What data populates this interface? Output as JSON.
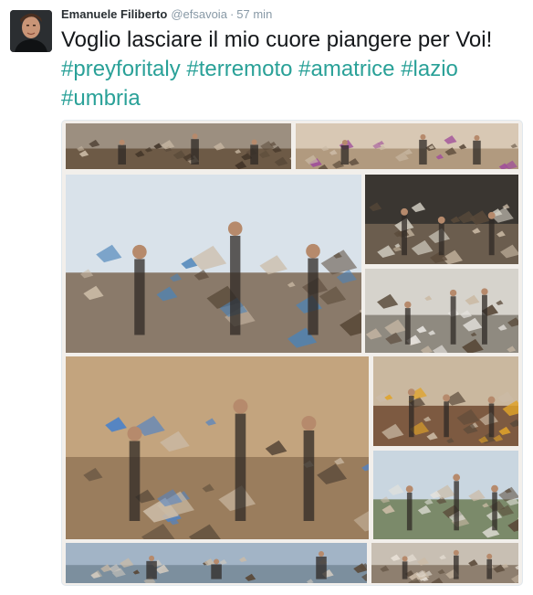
{
  "tweet": {
    "author_name": "Emanuele Filiberto",
    "handle": "@efsavoia",
    "separator": "·",
    "time": "57 min",
    "text_plain": "Voglio lasciare il mio cuore piangere per Voi! ",
    "hashtags": [
      "#preyforitaly",
      "#terremoto",
      "#amatrice",
      "#lazio",
      "#umbria"
    ]
  },
  "colors": {
    "name": "#292f33",
    "meta": "#8899a6",
    "hashtag": "#2aa198",
    "text": "#14171a"
  },
  "photos": [
    {
      "id": "rubble-top-left",
      "sky": "#9c8f80",
      "ground": "#6d5a46",
      "accent": "#3b2e22"
    },
    {
      "id": "rubble-top-right",
      "sky": "#d8c8b4",
      "ground": "#b19a7f",
      "accent": "#a04f9a"
    },
    {
      "id": "street-rescuers",
      "sky": "#d9e2ea",
      "ground": "#8a7a6a",
      "accent": "#4b83b8"
    },
    {
      "id": "night-rescue",
      "sky": "#3a3631",
      "ground": "#6b5d4e",
      "accent": "#d8d4c8"
    },
    {
      "id": "man-white-hair",
      "sky": "#d6d3cc",
      "ground": "#8f8a80",
      "accent": "#e6e3de"
    },
    {
      "id": "woman-blanket",
      "sky": "#c3a47e",
      "ground": "#9a7d5d",
      "accent": "#4f83c6"
    },
    {
      "id": "excavator",
      "sky": "#cab89f",
      "ground": "#7d5a41",
      "accent": "#e0a32a"
    },
    {
      "id": "aerial-collapse",
      "sky": "#c9d6e0",
      "ground": "#7b8a6a",
      "accent": "#e4e2dc"
    },
    {
      "id": "aerial-town",
      "sky": "#a2b4c6",
      "ground": "#7c8f9e",
      "accent": "#cfc9bf"
    },
    {
      "id": "ruined-facade",
      "sky": "#c8bfb3",
      "ground": "#8e7f6f",
      "accent": "#e6dfd5"
    }
  ]
}
